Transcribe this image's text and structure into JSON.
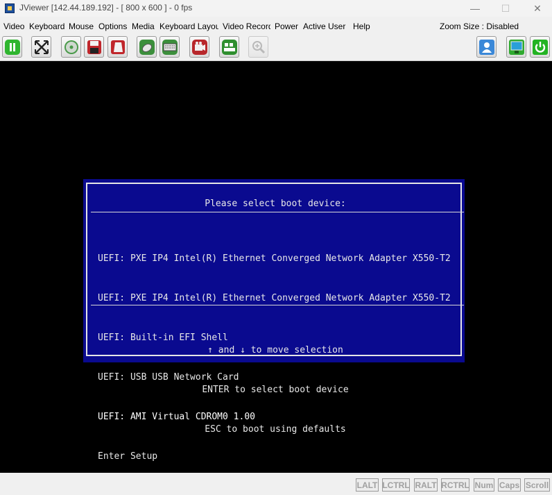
{
  "window": {
    "title": "JViewer [142.44.189.192] - [ 800 x 600 ] - 0 fps"
  },
  "menu": {
    "items": [
      "Video",
      "Keyboard",
      "Mouse",
      "Options",
      "Media",
      "Keyboard Layout",
      "Video Record",
      "Power",
      "Active User",
      "Help"
    ],
    "zoom_label": "Zoom Size : Disabled"
  },
  "toolbar": {
    "buttons": [
      "pause-icon",
      "fullscreen-icon",
      "cd-media-icon",
      "floppy-media-icon",
      "usb-media-icon",
      "mouse-icon",
      "keyboard-icon",
      "video-record-icon",
      "hotkeys-icon",
      "zoom-icon",
      "active-users-icon",
      "display-icon",
      "power-icon"
    ]
  },
  "boot_menu": {
    "title": "Please select boot device:",
    "options": [
      "UEFI: PXE IP4 Intel(R) Ethernet Converged Network Adapter X550-T2",
      "UEFI: PXE IP4 Intel(R) Ethernet Converged Network Adapter X550-T2",
      "UEFI: Built-in EFI Shell",
      "UEFI: USB USB Network Card",
      "UEFI: AMI Virtual CDROM0 1.00",
      "Enter Setup"
    ],
    "selected_index": 4,
    "help": [
      "↑ and ↓ to move selection",
      "ENTER to select boot device",
      "ESC to boot using defaults"
    ]
  },
  "status_keys": [
    "LALT",
    "LCTRL",
    "RALT",
    "RCTRL",
    "Num",
    "Caps",
    "Scroll"
  ],
  "colors": {
    "boot_bg": "#0a0a8f",
    "screen_bg": "#000000",
    "key_text": "#a0a0a0"
  }
}
